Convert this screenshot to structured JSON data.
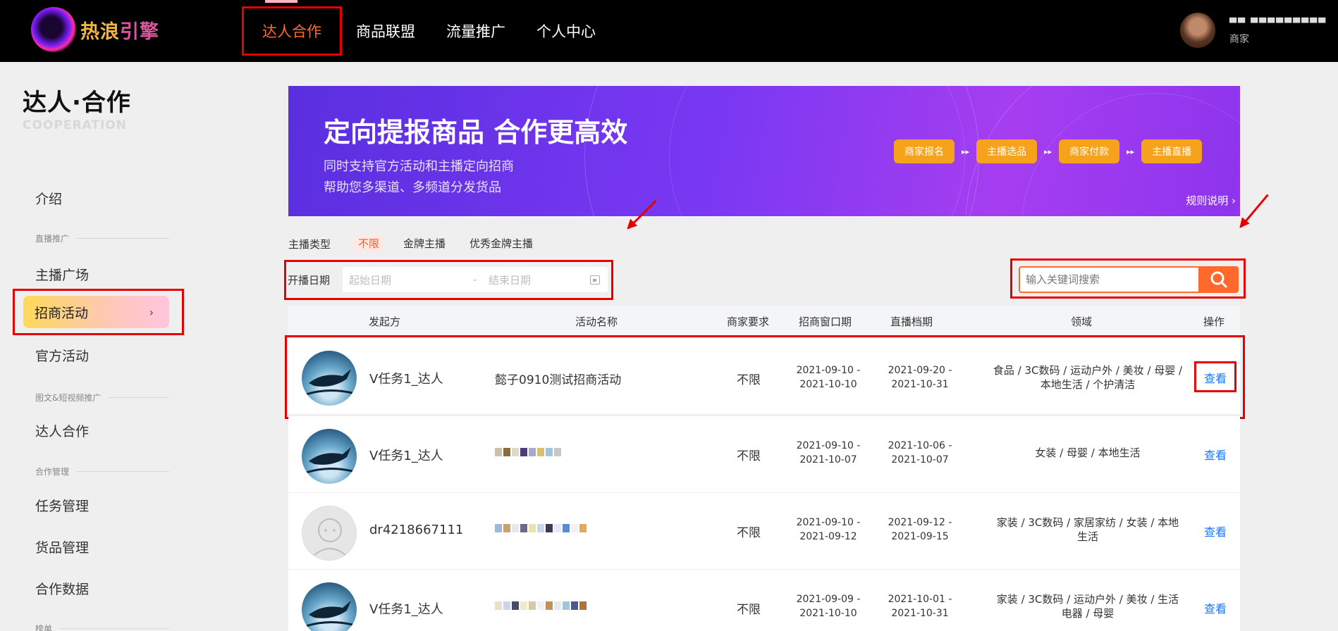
{
  "brand": {
    "name_part1": "热浪",
    "name_part2": "引擎"
  },
  "nav": [
    "达人合作",
    "商品联盟",
    "流量推广",
    "个人中心"
  ],
  "user": {
    "name": "▀▀ ▀▀▀▀▀▀▀▀▀",
    "role": "商家"
  },
  "sidebar": {
    "title": "达人·合作",
    "subtitle": "COOPERATION",
    "intro": "介绍",
    "group1": "直播推广",
    "item_anchor_square": "主播广场",
    "item_recruit": "招商活动",
    "item_official": "官方活动",
    "group2": "图文&短视频推广",
    "item_talent": "达人合作",
    "group3": "合作管理",
    "item_tasks": "任务管理",
    "item_goods": "货品管理",
    "item_data": "合作数据",
    "group4": "榜单"
  },
  "banner": {
    "title": "定向提报商品 合作更高效",
    "desc1": "同时支持官方活动和主播定向招商",
    "desc2": "帮助您多渠道、多频道分发货品",
    "steps": [
      "商家报名",
      "主播选品",
      "商家付款",
      "主播直播"
    ],
    "rules": "规则说明"
  },
  "filters": {
    "anchor_type_label": "主播类型",
    "anchor_types": [
      "不限",
      "金牌主播",
      "优秀金牌主播"
    ],
    "date_label": "开播日期",
    "start_placeholder": "起始日期",
    "end_placeholder": "结束日期",
    "search_placeholder": "输入关键词搜索"
  },
  "table": {
    "headers": [
      "发起方",
      "活动名称",
      "商家要求",
      "招商窗口期",
      "直播档期",
      "领域",
      "操作"
    ],
    "rows": [
      {
        "initiator": "V任务1_达人",
        "activity": "懿子0910测试招商活动",
        "requirement": "不限",
        "window_start": "2021-09-10 -",
        "window_end": "2021-10-10",
        "live_start": "2021-09-20 -",
        "live_end": "2021-10-31",
        "field1": "食品 / 3C数码 / 运动户外 / 美妆 / 母婴 /",
        "field2": "本地生活 / 个护清洁",
        "action": "查看"
      },
      {
        "initiator": "V任务1_达人",
        "activity": "",
        "requirement": "不限",
        "window_start": "2021-09-10 -",
        "window_end": "2021-10-07",
        "live_start": "2021-10-06 -",
        "live_end": "2021-10-07",
        "field1": "女装 / 母婴 / 本地生活",
        "field2": "",
        "action": "查看"
      },
      {
        "initiator": "dr4218667111",
        "activity": "",
        "requirement": "不限",
        "window_start": "2021-09-10 -",
        "window_end": "2021-09-12",
        "live_start": "2021-09-12 -",
        "live_end": "2021-09-15",
        "field1": "家装 / 3C数码 / 家居家纺 / 女装 / 本地",
        "field2": "生活",
        "action": "查看"
      },
      {
        "initiator": "V任务1_达人",
        "activity": "",
        "requirement": "不限",
        "window_start": "2021-09-09 -",
        "window_end": "2021-10-10",
        "live_start": "2021-10-01 -",
        "live_end": "2021-10-31",
        "field1": "家装 / 3C数码 / 运动户外 / 美妆 / 生活",
        "field2": "电器 / 母婴",
        "action": "查看"
      }
    ]
  },
  "colors": {
    "accent": "#ff6a2c",
    "highlight": "#e60000",
    "link": "#1677ff",
    "banner": "#7a38f2",
    "step": "#f7a21b"
  }
}
